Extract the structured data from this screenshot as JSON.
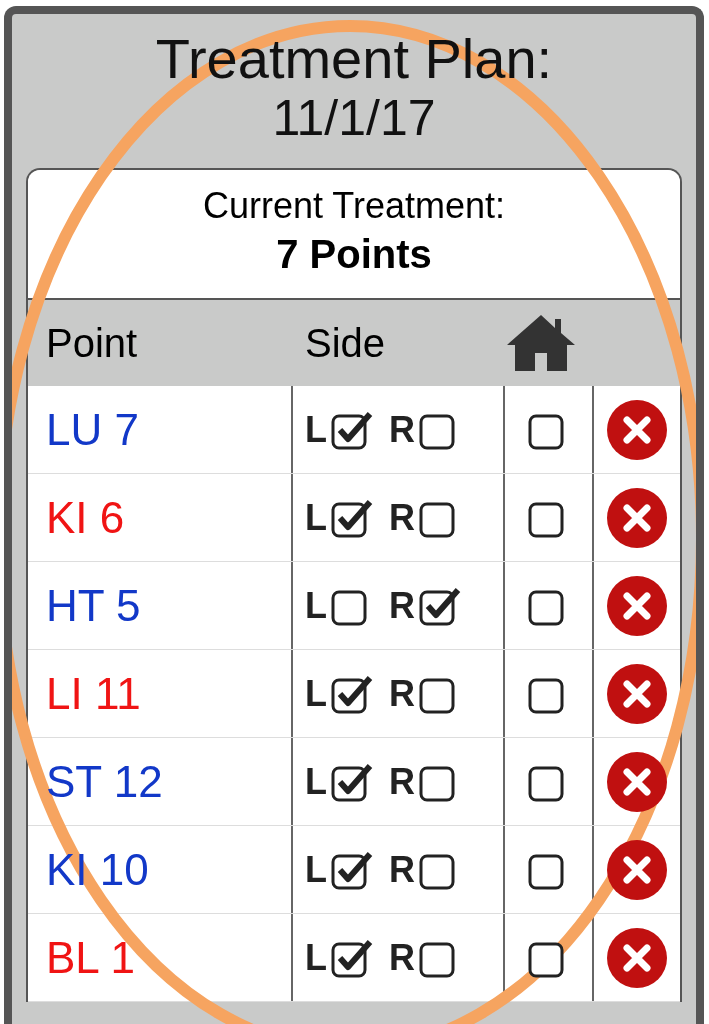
{
  "title": "Treatment Plan:",
  "date": "11/1/17",
  "summary": {
    "label": "Current Treatment:",
    "value": "7 Points"
  },
  "columns": [
    "Point",
    "Side"
  ],
  "points": [
    {
      "name": "LU 7",
      "color": "#1238c8",
      "left_label": "L",
      "left": true,
      "right_label": "R",
      "right": false,
      "home": false
    },
    {
      "name": "KI 6",
      "color": "#f01414",
      "left_label": "L",
      "left": true,
      "right_label": "R",
      "right": false,
      "home": false
    },
    {
      "name": "HT 5",
      "color": "#1238c8",
      "left_label": "L",
      "left": false,
      "right_label": "R",
      "right": true,
      "home": false
    },
    {
      "name": "LI 11",
      "color": "#f01414",
      "left_label": "L",
      "left": true,
      "right_label": "R",
      "right": false,
      "home": false
    },
    {
      "name": "ST 12",
      "color": "#1238c8",
      "left_label": "L",
      "left": true,
      "right_label": "R",
      "right": false,
      "home": false
    },
    {
      "name": "KI 10",
      "color": "#1238c8",
      "left_label": "L",
      "left": true,
      "right_label": "R",
      "right": false,
      "home": false
    },
    {
      "name": "BL 1",
      "color": "#f01414",
      "left_label": "L",
      "left": true,
      "right_label": "R",
      "right": false,
      "home": false
    }
  ]
}
